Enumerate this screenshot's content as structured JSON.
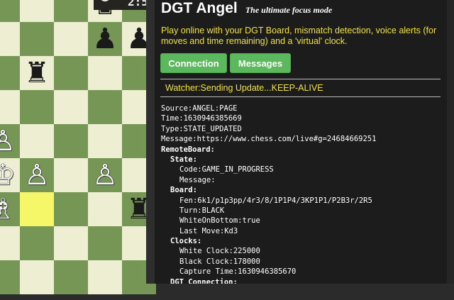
{
  "board": {
    "pieces": [
      {
        "glyph": "♚",
        "color": "black",
        "name": "black-king",
        "col": 2,
        "row": 0
      },
      {
        "glyph": "♟",
        "color": "black",
        "name": "black-pawn",
        "col": 2,
        "row": 1
      },
      {
        "glyph": "♟",
        "color": "black",
        "name": "black-pawn",
        "col": 3,
        "row": 1
      },
      {
        "glyph": "♜",
        "color": "black",
        "name": "black-rook",
        "col": 0,
        "row": 2
      },
      {
        "glyph": "♙",
        "color": "white",
        "name": "white-pawn",
        "col": -1,
        "row": 4
      },
      {
        "glyph": "♔",
        "color": "white",
        "name": "white-king",
        "col": -1,
        "row": 5
      },
      {
        "glyph": "♙",
        "color": "white",
        "name": "white-pawn",
        "col": 0,
        "row": 5
      },
      {
        "glyph": "♙",
        "color": "white",
        "name": "white-pawn",
        "col": 2,
        "row": 5
      },
      {
        "glyph": "♗",
        "color": "white",
        "name": "white-bishop",
        "col": -1,
        "row": 6
      },
      {
        "glyph": "♜",
        "color": "black",
        "name": "black-rook",
        "col": 3,
        "row": 6
      }
    ],
    "highlighted": [
      {
        "col": 0,
        "row": 6
      }
    ],
    "clock_text": "2:5"
  },
  "panel": {
    "title": "DGT Angel",
    "subtitle": "The ultimate focus mode",
    "description": "Play online with your DGT Board, mismatch detection, voice alerts (for moves and time remaining) and a 'virtual' clock.",
    "buttons": {
      "connection": "Connection",
      "messages": "Messages"
    },
    "watcher_status": "Watcher:Sending Update...KEEP-ALIVE",
    "colors": {
      "accent_yellow": "#f2e23a",
      "button_green": "#5cb85c",
      "panel_bg": "#1c1c1c"
    }
  },
  "log": [
    {
      "text": "Source:ANGEL:PAGE",
      "indent": 0,
      "bold": false
    },
    {
      "text": "Time:1630946385669",
      "indent": 0,
      "bold": false
    },
    {
      "text": "Type:STATE_UPDATED",
      "indent": 0,
      "bold": false
    },
    {
      "text": "Message:https://www.chess.com/live#g=24684669251",
      "indent": 0,
      "bold": false
    },
    {
      "text": "RemoteBoard:",
      "indent": 0,
      "bold": true
    },
    {
      "text": "State:",
      "indent": 1,
      "bold": true
    },
    {
      "text": "Code:GAME_IN_PROGRESS",
      "indent": 2,
      "bold": false
    },
    {
      "text": "Message:",
      "indent": 2,
      "bold": false
    },
    {
      "text": "Board:",
      "indent": 1,
      "bold": true
    },
    {
      "text": "Fen:6k1/p1p3pp/4r3/8/1P1P4/3KP1P1/P2B3r/2R5",
      "indent": 2,
      "bold": false
    },
    {
      "text": "Turn:BLACK",
      "indent": 2,
      "bold": false
    },
    {
      "text": "WhiteOnBottom:true",
      "indent": 2,
      "bold": false
    },
    {
      "text": "Last Move:Kd3",
      "indent": 2,
      "bold": false
    },
    {
      "text": "Clocks:",
      "indent": 1,
      "bold": true
    },
    {
      "text": "White Clock:225000",
      "indent": 2,
      "bold": false
    },
    {
      "text": "Black Clock:178000",
      "indent": 2,
      "bold": false
    },
    {
      "text": "Capture Time:1630946385670",
      "indent": 2,
      "bold": false
    },
    {
      "text": "DGT Connection:",
      "indent": 1,
      "bold": true
    }
  ]
}
